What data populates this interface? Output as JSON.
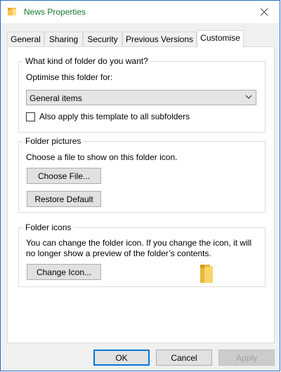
{
  "window": {
    "title_name": "News",
    "title_suffix": "Properties",
    "close_glyph": "×"
  },
  "tabs": [
    {
      "label": "General"
    },
    {
      "label": "Sharing"
    },
    {
      "label": "Security"
    },
    {
      "label": "Previous Versions"
    },
    {
      "label": "Customise"
    }
  ],
  "active_tab": "Customise",
  "folder_type": {
    "group_label": "What kind of folder do you want?",
    "optimise_label": "Optimise this folder for:",
    "selected": "General items",
    "apply_subfolders_label": "Also apply this template to all subfolders",
    "apply_subfolders_checked": false
  },
  "folder_pictures": {
    "group_label": "Folder pictures",
    "description": "Choose a file to show on this folder icon.",
    "choose_button": "Choose File...",
    "restore_button": "Restore Default"
  },
  "folder_icons": {
    "group_label": "Folder icons",
    "description_line1": "You can change the folder icon. If you change the icon, it will",
    "description_line2": "no longer show a preview of the folder’s contents.",
    "change_button": "Change Icon..."
  },
  "footer": {
    "ok": "OK",
    "cancel": "Cancel",
    "apply": "Apply"
  },
  "colors": {
    "accent": "#0078d7",
    "folder": "#f5c451",
    "title_suffix": "#1a7a2e"
  },
  "icons": [
    "folder-icon",
    "close-icon",
    "chevron-down-icon"
  ]
}
